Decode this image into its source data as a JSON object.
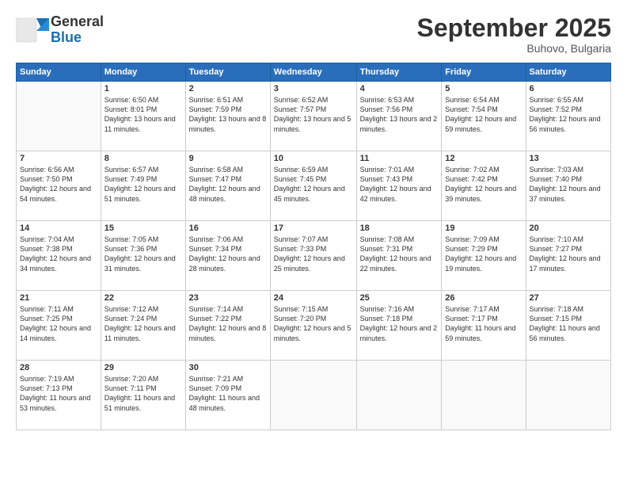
{
  "logo": {
    "general": "General",
    "blue": "Blue"
  },
  "header": {
    "month": "September 2025",
    "location": "Buhovo, Bulgaria"
  },
  "days": [
    "Sunday",
    "Monday",
    "Tuesday",
    "Wednesday",
    "Thursday",
    "Friday",
    "Saturday"
  ],
  "weeks": [
    [
      {
        "num": "",
        "sunrise": "",
        "sunset": "",
        "daylight": ""
      },
      {
        "num": "1",
        "sunrise": "Sunrise: 6:50 AM",
        "sunset": "Sunset: 8:01 PM",
        "daylight": "Daylight: 13 hours and 11 minutes."
      },
      {
        "num": "2",
        "sunrise": "Sunrise: 6:51 AM",
        "sunset": "Sunset: 7:59 PM",
        "daylight": "Daylight: 13 hours and 8 minutes."
      },
      {
        "num": "3",
        "sunrise": "Sunrise: 6:52 AM",
        "sunset": "Sunset: 7:57 PM",
        "daylight": "Daylight: 13 hours and 5 minutes."
      },
      {
        "num": "4",
        "sunrise": "Sunrise: 6:53 AM",
        "sunset": "Sunset: 7:56 PM",
        "daylight": "Daylight: 13 hours and 2 minutes."
      },
      {
        "num": "5",
        "sunrise": "Sunrise: 6:54 AM",
        "sunset": "Sunset: 7:54 PM",
        "daylight": "Daylight: 12 hours and 59 minutes."
      },
      {
        "num": "6",
        "sunrise": "Sunrise: 6:55 AM",
        "sunset": "Sunset: 7:52 PM",
        "daylight": "Daylight: 12 hours and 56 minutes."
      }
    ],
    [
      {
        "num": "7",
        "sunrise": "Sunrise: 6:56 AM",
        "sunset": "Sunset: 7:50 PM",
        "daylight": "Daylight: 12 hours and 54 minutes."
      },
      {
        "num": "8",
        "sunrise": "Sunrise: 6:57 AM",
        "sunset": "Sunset: 7:49 PM",
        "daylight": "Daylight: 12 hours and 51 minutes."
      },
      {
        "num": "9",
        "sunrise": "Sunrise: 6:58 AM",
        "sunset": "Sunset: 7:47 PM",
        "daylight": "Daylight: 12 hours and 48 minutes."
      },
      {
        "num": "10",
        "sunrise": "Sunrise: 6:59 AM",
        "sunset": "Sunset: 7:45 PM",
        "daylight": "Daylight: 12 hours and 45 minutes."
      },
      {
        "num": "11",
        "sunrise": "Sunrise: 7:01 AM",
        "sunset": "Sunset: 7:43 PM",
        "daylight": "Daylight: 12 hours and 42 minutes."
      },
      {
        "num": "12",
        "sunrise": "Sunrise: 7:02 AM",
        "sunset": "Sunset: 7:42 PM",
        "daylight": "Daylight: 12 hours and 39 minutes."
      },
      {
        "num": "13",
        "sunrise": "Sunrise: 7:03 AM",
        "sunset": "Sunset: 7:40 PM",
        "daylight": "Daylight: 12 hours and 37 minutes."
      }
    ],
    [
      {
        "num": "14",
        "sunrise": "Sunrise: 7:04 AM",
        "sunset": "Sunset: 7:38 PM",
        "daylight": "Daylight: 12 hours and 34 minutes."
      },
      {
        "num": "15",
        "sunrise": "Sunrise: 7:05 AM",
        "sunset": "Sunset: 7:36 PM",
        "daylight": "Daylight: 12 hours and 31 minutes."
      },
      {
        "num": "16",
        "sunrise": "Sunrise: 7:06 AM",
        "sunset": "Sunset: 7:34 PM",
        "daylight": "Daylight: 12 hours and 28 minutes."
      },
      {
        "num": "17",
        "sunrise": "Sunrise: 7:07 AM",
        "sunset": "Sunset: 7:33 PM",
        "daylight": "Daylight: 12 hours and 25 minutes."
      },
      {
        "num": "18",
        "sunrise": "Sunrise: 7:08 AM",
        "sunset": "Sunset: 7:31 PM",
        "daylight": "Daylight: 12 hours and 22 minutes."
      },
      {
        "num": "19",
        "sunrise": "Sunrise: 7:09 AM",
        "sunset": "Sunset: 7:29 PM",
        "daylight": "Daylight: 12 hours and 19 minutes."
      },
      {
        "num": "20",
        "sunrise": "Sunrise: 7:10 AM",
        "sunset": "Sunset: 7:27 PM",
        "daylight": "Daylight: 12 hours and 17 minutes."
      }
    ],
    [
      {
        "num": "21",
        "sunrise": "Sunrise: 7:11 AM",
        "sunset": "Sunset: 7:25 PM",
        "daylight": "Daylight: 12 hours and 14 minutes."
      },
      {
        "num": "22",
        "sunrise": "Sunrise: 7:12 AM",
        "sunset": "Sunset: 7:24 PM",
        "daylight": "Daylight: 12 hours and 11 minutes."
      },
      {
        "num": "23",
        "sunrise": "Sunrise: 7:14 AM",
        "sunset": "Sunset: 7:22 PM",
        "daylight": "Daylight: 12 hours and 8 minutes."
      },
      {
        "num": "24",
        "sunrise": "Sunrise: 7:15 AM",
        "sunset": "Sunset: 7:20 PM",
        "daylight": "Daylight: 12 hours and 5 minutes."
      },
      {
        "num": "25",
        "sunrise": "Sunrise: 7:16 AM",
        "sunset": "Sunset: 7:18 PM",
        "daylight": "Daylight: 12 hours and 2 minutes."
      },
      {
        "num": "26",
        "sunrise": "Sunrise: 7:17 AM",
        "sunset": "Sunset: 7:17 PM",
        "daylight": "Daylight: 11 hours and 59 minutes."
      },
      {
        "num": "27",
        "sunrise": "Sunrise: 7:18 AM",
        "sunset": "Sunset: 7:15 PM",
        "daylight": "Daylight: 11 hours and 56 minutes."
      }
    ],
    [
      {
        "num": "28",
        "sunrise": "Sunrise: 7:19 AM",
        "sunset": "Sunset: 7:13 PM",
        "daylight": "Daylight: 11 hours and 53 minutes."
      },
      {
        "num": "29",
        "sunrise": "Sunrise: 7:20 AM",
        "sunset": "Sunset: 7:11 PM",
        "daylight": "Daylight: 11 hours and 51 minutes."
      },
      {
        "num": "30",
        "sunrise": "Sunrise: 7:21 AM",
        "sunset": "Sunset: 7:09 PM",
        "daylight": "Daylight: 11 hours and 48 minutes."
      },
      {
        "num": "",
        "sunrise": "",
        "sunset": "",
        "daylight": ""
      },
      {
        "num": "",
        "sunrise": "",
        "sunset": "",
        "daylight": ""
      },
      {
        "num": "",
        "sunrise": "",
        "sunset": "",
        "daylight": ""
      },
      {
        "num": "",
        "sunrise": "",
        "sunset": "",
        "daylight": ""
      }
    ]
  ]
}
